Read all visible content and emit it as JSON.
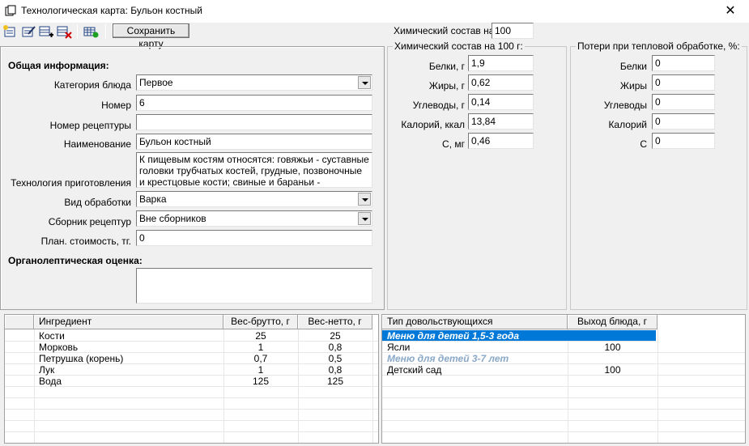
{
  "window": {
    "title": "Технологическая карта: Бульон костный",
    "close_glyph": "✕"
  },
  "toolbar": {
    "icons": [
      "new-card-icon",
      "edit-card-icon",
      "add-row-icon",
      "delete-row-icon",
      "grid-add-icon"
    ],
    "save_label": "Сохранить карту"
  },
  "chem_on": {
    "label": "Химический состав на:",
    "value": "100"
  },
  "general": {
    "heading": "Общая информация:",
    "category_label": "Категория блюда",
    "category_value": "Первое",
    "number_label": "Номер",
    "number_value": "6",
    "recipe_no_label": "Номер рецептуры",
    "recipe_no_value": "",
    "name_label": "Наименование",
    "name_value": "Бульон костный",
    "tech_label": "Технология приготовления",
    "tech_value": "К пищевым костям относятся: говяжьи - суставные головки трубчатых костей, грудные, позвоночные и крестцовые кости; свиные и бараньи - позвоночные,",
    "processing_label": "Вид обработки",
    "processing_value": "Варка",
    "collection_label": "Сборник рецептур",
    "collection_value": "Вне сборников",
    "cost_label": "План. стоимость, тг.",
    "cost_value": "0",
    "organoleptic_heading": "Органолептическая оценка:",
    "organoleptic_value": ""
  },
  "chem": {
    "title": "Химический состав на 100 г:",
    "rows": [
      {
        "label": "Белки, г",
        "value": "1,9"
      },
      {
        "label": "Жиры, г",
        "value": "0,62"
      },
      {
        "label": "Углеводы, г",
        "value": "0,14"
      },
      {
        "label": "Калорий, ккал",
        "value": "13,84"
      },
      {
        "label": "С, мг",
        "value": "0,46"
      }
    ]
  },
  "losses": {
    "title": "Потери при тепловой обработке, %:",
    "rows": [
      {
        "label": "Белки",
        "value": "0"
      },
      {
        "label": "Жиры",
        "value": "0"
      },
      {
        "label": "Углеводы",
        "value": "0"
      },
      {
        "label": "Калорий",
        "value": "0"
      },
      {
        "label": "С",
        "value": "0"
      }
    ]
  },
  "ingredients": {
    "headers": {
      "name": "Ингредиент",
      "gross": "Вес-брутто, г",
      "net": "Вес-нетто, г"
    },
    "rows": [
      {
        "name": "Кости",
        "gross": "25",
        "net": "25"
      },
      {
        "name": "Морковь",
        "gross": "1",
        "net": "0,8"
      },
      {
        "name": "Петрушка (корень)",
        "gross": "0,7",
        "net": "0,5"
      },
      {
        "name": "Лук",
        "gross": "1",
        "net": "0,8"
      },
      {
        "name": "Вода",
        "gross": "125",
        "net": "125"
      }
    ]
  },
  "consumers": {
    "headers": {
      "type": "Тип довольствующихся",
      "yield": "Выход блюда, г"
    },
    "rows": [
      {
        "type": "Меню для детей 1,5-3 года",
        "yield": ""
      },
      {
        "type": "Ясли",
        "yield": "100"
      },
      {
        "type": "Меню для детей 3-7 лет",
        "yield": ""
      },
      {
        "type": "Детский сад",
        "yield": "100"
      }
    ]
  }
}
